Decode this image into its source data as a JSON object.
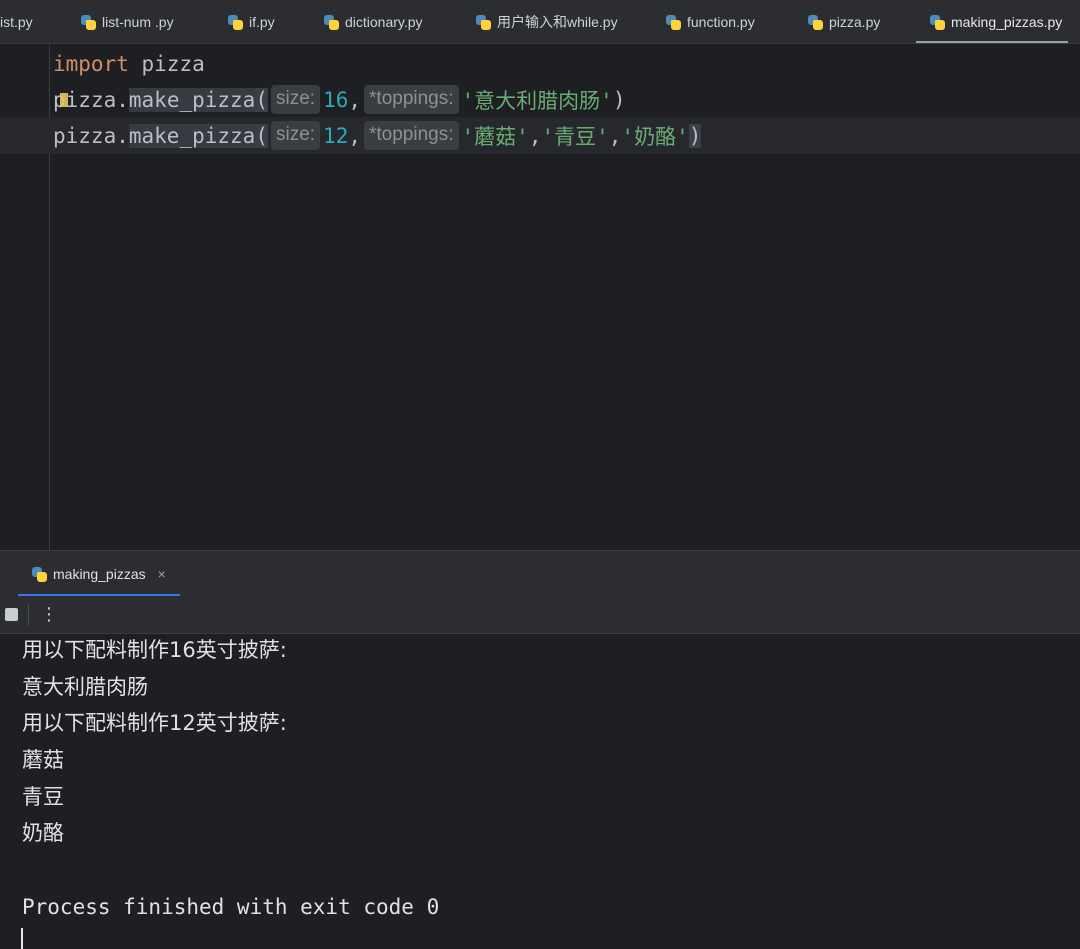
{
  "tabs": [
    {
      "label": "ist.py",
      "active": false,
      "icon": false
    },
    {
      "label": "list-num .py",
      "active": false,
      "icon": true
    },
    {
      "label": "if.py",
      "active": false,
      "icon": true
    },
    {
      "label": "dictionary.py",
      "active": false,
      "icon": true
    },
    {
      "label": "用户输入和while.py",
      "active": false,
      "icon": true
    },
    {
      "label": "function.py",
      "active": false,
      "icon": true
    },
    {
      "label": "pizza.py",
      "active": false,
      "icon": true
    },
    {
      "label": "making_pizzas.py",
      "active": true,
      "icon": true
    }
  ],
  "code": {
    "line1": {
      "keyword": "import",
      "module": "pizza"
    },
    "line2": {
      "object_p": "p",
      "object_rest": "izza",
      "dot": ".",
      "function": "make_pizza",
      "open_paren": "(",
      "hint_size": "size:",
      "size_value": "16",
      "comma": ",",
      "hint_toppings": "*toppings:",
      "arg1": "'意大利腊肉肠'",
      "close_paren": ")"
    },
    "line3": {
      "object": "pizza",
      "dot": ".",
      "function": "make_pizza",
      "open_paren": "(",
      "hint_size": "size:",
      "size_value": "12",
      "comma": ",",
      "hint_toppings": "*toppings:",
      "arg1": "'蘑菇'",
      "sep1": ",",
      "arg2": "'青豆'",
      "sep2": ",",
      "arg3": "'奶酪'",
      "close_paren": ")"
    }
  },
  "run": {
    "tab_label": "making_pizzas",
    "close_glyph": "×",
    "more_glyph": "⋮",
    "output": [
      "用以下配料制作16英寸披萨:",
      "意大利腊肉肠",
      "用以下配料制作12英寸披萨:",
      "蘑菇",
      "青豆",
      "奶酪",
      "",
      "Process finished with exit code 0"
    ]
  },
  "colors": {
    "background": "#1e1f22",
    "keyword": "#cf8e6d",
    "number": "#2aacb8",
    "string": "#6aab73",
    "accent_tab": "#3574f0"
  }
}
